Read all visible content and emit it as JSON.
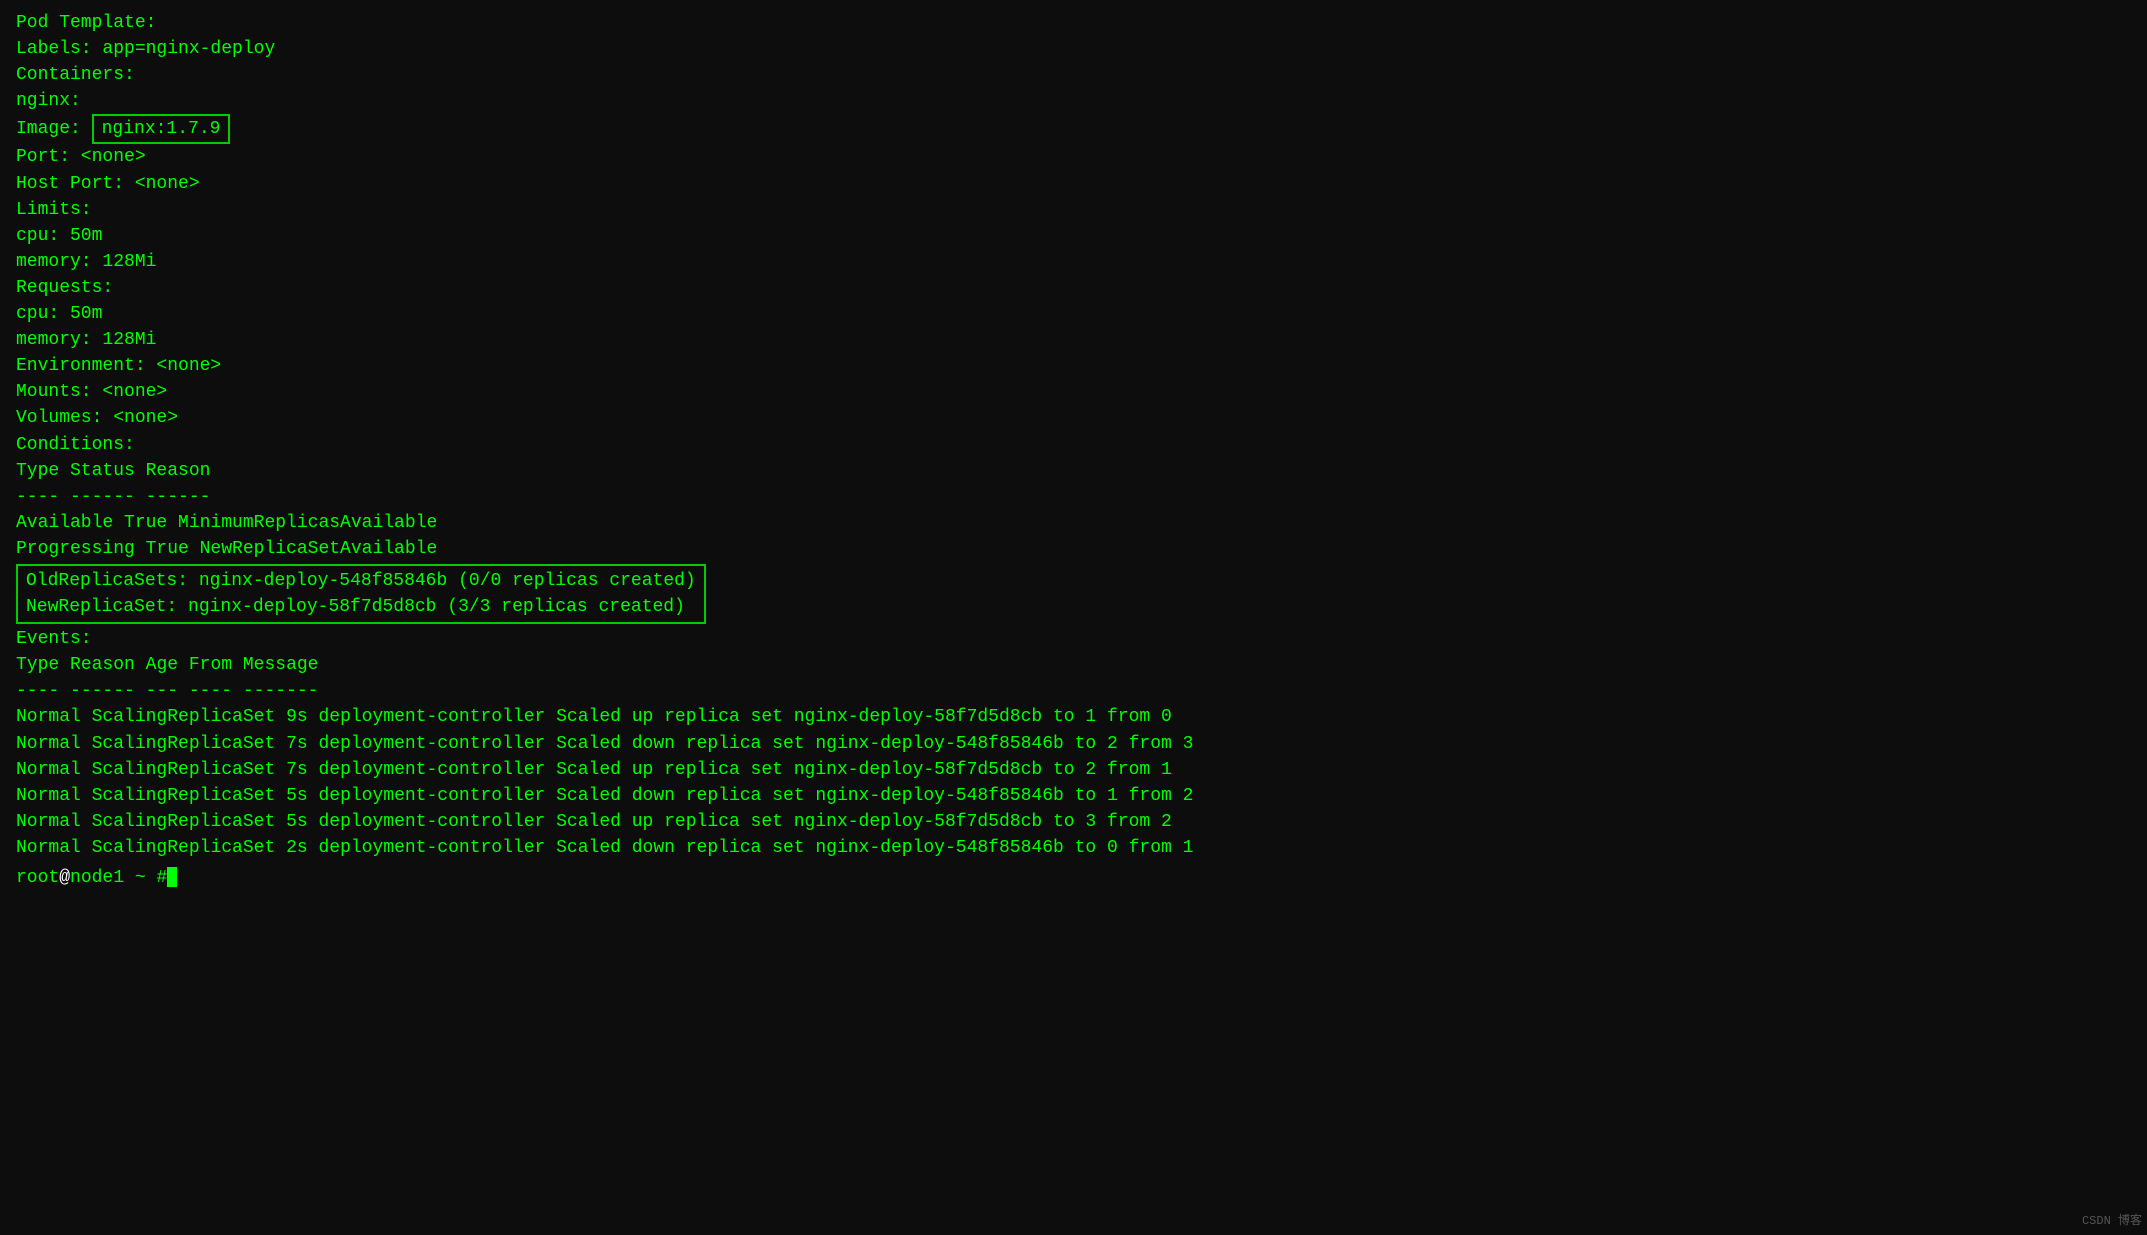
{
  "terminal": {
    "pod_template": {
      "label": "Pod Template:",
      "labels_line": "  Labels:   app=nginx-deploy",
      "containers_line": "  Containers:",
      "nginx_label": "    nginx:",
      "image_label": "    Image:    ",
      "image_value": "nginx:1.7.9",
      "port_line": "    Port:      <none>",
      "host_port_line": "    Host Port: <none>",
      "limits_line": "    Limits:",
      "cpu_limit": "      cpu:      50m",
      "memory_limit": "      memory:   128Mi",
      "requests_line": "    Requests:",
      "cpu_request": "      cpu:      50m",
      "memory_request": "      memory:   128Mi",
      "environment_line": "    Environment: <none>",
      "mounts_line": "    Mounts:      <none>",
      "volumes_line": "  Volumes:       <none>"
    },
    "conditions": {
      "label": "Conditions:",
      "header": "  Type              Status  Reason",
      "divider": "  ----              ------  ------",
      "available": "  Available         True    MinimumReplicasAvailable",
      "progressing": "  Progressing       True    NewReplicaSetAvailable"
    },
    "replica_sets": {
      "old_label": "OldReplicaSets:",
      "old_value": "nginx-deploy-548f85846b (0/0 replicas created)",
      "new_label": "NewReplicaSet: ",
      "new_value": "nginx-deploy-58f7d5d8cb (3/3 replicas created)"
    },
    "events": {
      "label": "Events:",
      "header": {
        "type": "  Type    ",
        "reason": "Reason              ",
        "age": "Age   ",
        "from": "From                    ",
        "message": "Message"
      },
      "divider": {
        "type": "  ----    ",
        "reason": "------              ",
        "age": "---   ",
        "from": "----                    ",
        "message": "-------"
      },
      "rows": [
        {
          "type": "Normal",
          "reason": "ScalingReplicaSet",
          "age": "9s",
          "from": "deployment-controller",
          "message": "Scaled up replica set nginx-deploy-58f7d5d8cb to 1 from 0"
        },
        {
          "type": "Normal",
          "reason": "ScalingReplicaSet",
          "age": "7s",
          "from": "deployment-controller",
          "message": "Scaled down replica set nginx-deploy-548f85846b to 2 from 3"
        },
        {
          "type": "Normal",
          "reason": "ScalingReplicaSet",
          "age": "7s",
          "from": "deployment-controller",
          "message": "Scaled up replica set nginx-deploy-58f7d5d8cb to 2 from 1"
        },
        {
          "type": "Normal",
          "reason": "ScalingReplicaSet",
          "age": "5s",
          "from": "deployment-controller",
          "message": "Scaled down replica set nginx-deploy-548f85846b to 1 from 2"
        },
        {
          "type": "Normal",
          "reason": "ScalingReplicaSet",
          "age": "5s",
          "from": "deployment-controller",
          "message": "Scaled up replica set nginx-deploy-58f7d5d8cb to 3 from 2"
        },
        {
          "type": "Normal",
          "reason": "ScalingReplicaSet",
          "age": "2s",
          "from": "deployment-controller",
          "message": "Scaled down replica set nginx-deploy-548f85846b to 0 from 1"
        }
      ]
    },
    "prompt": {
      "user": "root",
      "host": "node1",
      "dir": "~",
      "symbol": "#"
    }
  },
  "watermark": "CSDN 博客"
}
